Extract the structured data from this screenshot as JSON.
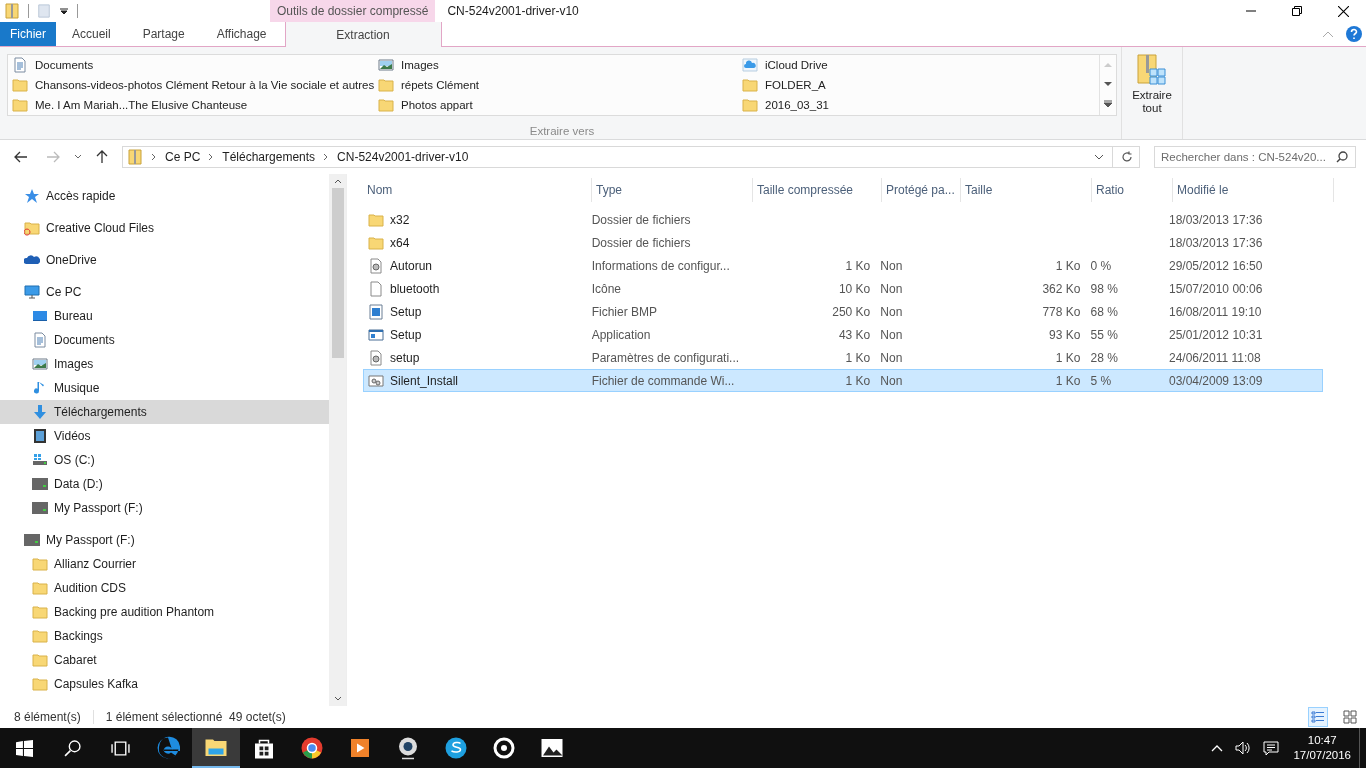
{
  "window": {
    "title": "CN-524v2001-driver-v10",
    "context_tab": "Outils de dossier compressé"
  },
  "ribbon_tabs": [
    {
      "label": "Fichier",
      "kind": "file",
      "selected": false
    },
    {
      "label": "Accueil",
      "kind": "tab",
      "selected": false
    },
    {
      "label": "Partage",
      "kind": "tab",
      "selected": false
    },
    {
      "label": "Affichage",
      "kind": "tab",
      "selected": false
    },
    {
      "label": "Extraction",
      "kind": "context",
      "selected": true
    }
  ],
  "destinations": [
    {
      "label": "Documents",
      "kind": "doc"
    },
    {
      "label": "Chansons-videos-photos Clément Retour à la Vie sociale et autres",
      "kind": "folder"
    },
    {
      "label": "Me. I Am Mariah...The Elusive Chanteuse",
      "kind": "folder"
    },
    {
      "label": "Images",
      "kind": "images"
    },
    {
      "label": "répets Clément",
      "kind": "folder"
    },
    {
      "label": "Photos appart",
      "kind": "folder"
    },
    {
      "label": "iCloud Drive",
      "kind": "icloud"
    },
    {
      "label": "FOLDER_A",
      "kind": "folder"
    },
    {
      "label": "2016_03_31",
      "kind": "folder"
    }
  ],
  "destinations_group": "Extraire vers",
  "extract_all": "Extraire tout",
  "breadcrumb": [
    "Ce PC",
    "Téléchargements",
    "CN-524v2001-driver-v10"
  ],
  "search": {
    "placeholder": "Rechercher dans : CN-524v20..."
  },
  "sidebar": [
    {
      "label": "Accès rapide",
      "kind": "star",
      "selected": false
    },
    {
      "label": "Creative Cloud Files",
      "kind": "cc",
      "selected": false
    },
    {
      "label": "OneDrive",
      "kind": "onedrive",
      "selected": false
    },
    {
      "label": "Ce PC",
      "kind": "pc",
      "selected": false,
      "children": [
        {
          "label": "Bureau",
          "kind": "desktop",
          "selected": false
        },
        {
          "label": "Documents",
          "kind": "doc",
          "selected": false
        },
        {
          "label": "Images",
          "kind": "images",
          "selected": false
        },
        {
          "label": "Musique",
          "kind": "music",
          "selected": false
        },
        {
          "label": "Téléchargements",
          "kind": "download",
          "selected": true
        },
        {
          "label": "Vidéos",
          "kind": "video",
          "selected": false
        },
        {
          "label": "OS (C:)",
          "kind": "osdrive",
          "selected": false
        },
        {
          "label": "Data (D:)",
          "kind": "drive",
          "selected": false
        },
        {
          "label": "My Passport (F:)",
          "kind": "drive",
          "selected": false
        }
      ]
    },
    {
      "label": "My Passport (F:)",
      "kind": "drive",
      "selected": false,
      "children": [
        {
          "label": "Allianz Courrier",
          "kind": "folder",
          "selected": false
        },
        {
          "label": "Audition CDS",
          "kind": "folder",
          "selected": false
        },
        {
          "label": "Backing pre audition Phantom",
          "kind": "folder",
          "selected": false
        },
        {
          "label": "Backings",
          "kind": "folder",
          "selected": false
        },
        {
          "label": "Cabaret",
          "kind": "folder",
          "selected": false
        },
        {
          "label": "Capsules Kafka",
          "kind": "folder",
          "selected": false
        }
      ]
    }
  ],
  "table": {
    "columns": [
      "Nom",
      "Type",
      "Taille compressée",
      "Protégé pa...",
      "Taille",
      "Ratio",
      "Modifié le"
    ],
    "rows": [
      {
        "name": "x32",
        "kind": "folder",
        "type": "Dossier de fichiers",
        "compressed": "",
        "protected": "",
        "size": "",
        "ratio": "",
        "modified": "18/03/2013 17:36",
        "selected": false
      },
      {
        "name": "x64",
        "kind": "folder",
        "type": "Dossier de fichiers",
        "compressed": "",
        "protected": "",
        "size": "",
        "ratio": "",
        "modified": "18/03/2013 17:36",
        "selected": false
      },
      {
        "name": "Autorun",
        "kind": "gearfile",
        "type": "Informations de configur...",
        "compressed": "1 Ko",
        "protected": "Non",
        "size": "1 Ko",
        "ratio": "0 %",
        "modified": "29/05/2012 16:50",
        "selected": false
      },
      {
        "name": "bluetooth",
        "kind": "blank",
        "type": "Icône",
        "compressed": "10 Ko",
        "protected": "Non",
        "size": "362 Ko",
        "ratio": "98 %",
        "modified": "15/07/2010 00:06",
        "selected": false
      },
      {
        "name": "Setup",
        "kind": "bmp",
        "type": "Fichier BMP",
        "compressed": "250 Ko",
        "protected": "Non",
        "size": "778 Ko",
        "ratio": "68 %",
        "modified": "16/08/2011 19:10",
        "selected": false
      },
      {
        "name": "Setup",
        "kind": "app",
        "type": "Application",
        "compressed": "43 Ko",
        "protected": "Non",
        "size": "93 Ko",
        "ratio": "55 %",
        "modified": "25/01/2012 10:31",
        "selected": false
      },
      {
        "name": "setup",
        "kind": "gearfile",
        "type": "Paramètres de configurati...",
        "compressed": "1 Ko",
        "protected": "Non",
        "size": "1 Ko",
        "ratio": "28 %",
        "modified": "24/06/2011 11:08",
        "selected": false
      },
      {
        "name": "Silent_Install",
        "kind": "bat",
        "type": "Fichier de commande Wi...",
        "compressed": "1 Ko",
        "protected": "Non",
        "size": "1 Ko",
        "ratio": "5 %",
        "modified": "03/04/2009 13:09",
        "selected": true
      }
    ]
  },
  "status_bar": {
    "count": "8 élément(s)",
    "selection": "1 élément sélectionné  49 octet(s)"
  },
  "taskbar": {
    "apps": [
      {
        "kind": "edge",
        "selected": false
      },
      {
        "kind": "explorer",
        "selected": true
      },
      {
        "kind": "store",
        "selected": false
      },
      {
        "kind": "chrome",
        "selected": false
      },
      {
        "kind": "player",
        "selected": false
      },
      {
        "kind": "webcam",
        "selected": false
      },
      {
        "kind": "skype",
        "selected": false
      },
      {
        "kind": "disc",
        "selected": false
      },
      {
        "kind": "photos",
        "selected": false
      }
    ],
    "time": "10:47",
    "date": "17/07/2016"
  }
}
